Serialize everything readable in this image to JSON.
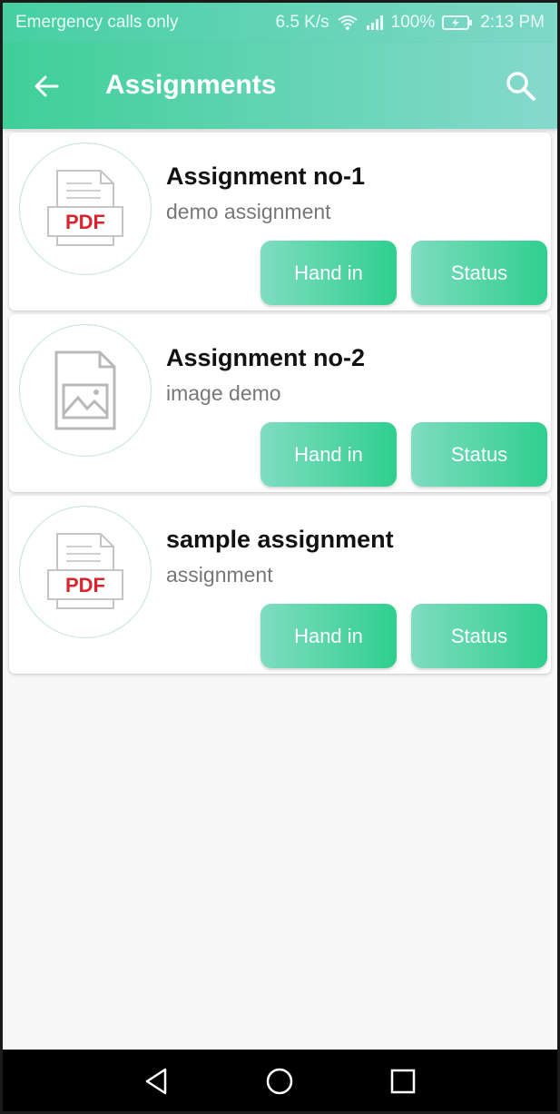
{
  "status_bar": {
    "carrier_text": "Emergency calls only",
    "network_speed": "6.5 K/s",
    "battery_percent": "100%",
    "time": "2:13 PM"
  },
  "app_bar": {
    "title": "Assignments",
    "back_icon": "arrow-left-icon",
    "search_icon": "search-icon"
  },
  "assignments": [
    {
      "title": "Assignment no-1",
      "description": "demo assignment",
      "file_type": "PDF",
      "hand_in_label": "Hand in",
      "status_label": "Status"
    },
    {
      "title": "Assignment no-2",
      "description": "image demo",
      "file_type": "image",
      "hand_in_label": "Hand in",
      "status_label": "Status"
    },
    {
      "title": "sample assignment",
      "description": "assignment",
      "file_type": "PDF",
      "hand_in_label": "Hand in",
      "status_label": "Status"
    }
  ],
  "colors": {
    "accent_start": "#3ecf98",
    "accent_end": "#86d9cd",
    "pdf_red": "#d9232d"
  },
  "nav_bar": {
    "back_icon": "triangle-back-icon",
    "home_icon": "circle-home-icon",
    "recents_icon": "square-recents-icon"
  }
}
